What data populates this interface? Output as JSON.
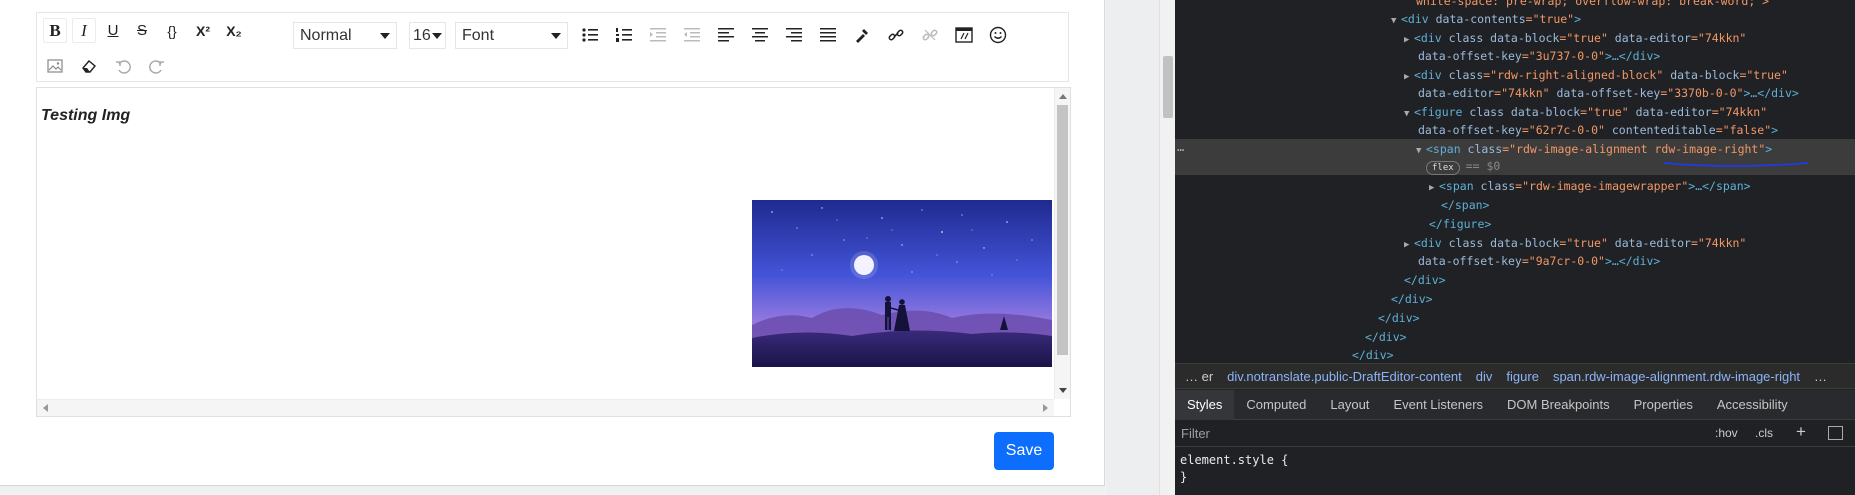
{
  "toolbar": {
    "buttons_row1": [
      {
        "name": "bold",
        "glyph": "B"
      },
      {
        "name": "italic",
        "glyph": "I"
      },
      {
        "name": "underline",
        "glyph": "U"
      },
      {
        "name": "strikethrough",
        "glyph": "S"
      },
      {
        "name": "code",
        "glyph": "{}"
      },
      {
        "name": "superscript",
        "glyph": "X²"
      },
      {
        "name": "subscript",
        "glyph": "X₂"
      }
    ],
    "block_type": "Normal",
    "font_size": "16",
    "font_family": "Font",
    "icons": [
      "unordered-list-icon",
      "ordered-list-icon",
      "indent-icon",
      "outdent-icon",
      "align-left-icon",
      "align-center-icon",
      "align-right-icon",
      "align-justify-icon",
      "color-picker-icon",
      "link-icon",
      "unlink-icon",
      "embed-icon",
      "emoji-icon",
      "image-icon",
      "eraser-icon",
      "undo-icon",
      "redo-icon"
    ]
  },
  "editor": {
    "text": "Testing Img",
    "image_icon": "night-sky-couple-image"
  },
  "save_label": "Save",
  "devtools": {
    "lines": {
      "l0": "white-space: pre-wrap; overflow-wrap: break-word;\">",
      "l1a": "<div ",
      "l1b": "data-contents",
      "l1c": "=\"true\"",
      "l1d": ">",
      "l2a": "<div ",
      "l2b": "class data-block",
      "l2c": "=\"true\"",
      "l2d": " data-editor",
      "l2e": "=\"74kkn\"",
      "l3a": "data-offset-key",
      "l3b": "=\"3u737-0-0\"",
      "l3c": ">…</div>",
      "l4a": "<div ",
      "l4b": "class",
      "l4c": "=\"rdw-right-aligned-block\"",
      "l4d": " data-block",
      "l4e": "=\"true\"",
      "l5a": "data-editor",
      "l5b": "=\"74kkn\"",
      "l5c": " data-offset-key",
      "l5d": "=\"3370b-0-0\"",
      "l5e": ">…</div>",
      "l6a": "<figure ",
      "l6b": "class data-block",
      "l6c": "=\"true\"",
      "l6d": " data-editor",
      "l6e": "=\"74kkn\"",
      "l7a": "data-offset-key",
      "l7b": "=\"62r7c-0-0\"",
      "l7c": " contenteditable",
      "l7d": "=\"false\"",
      "l7e": ">",
      "l8a": "<span ",
      "l8b": "class",
      "l8c": "=\"rdw-image-alignment rdw-image-right\"",
      "l8d": ">",
      "l9a": "flex",
      "l9b": "== $0",
      "l10a": "<span ",
      "l10b": "class",
      "l10c": "=\"rdw-image-imagewrapper\"",
      "l10d": ">…</span>",
      "l11": "</span>",
      "l12": "</figure>",
      "l13a": "<div ",
      "l13b": "class data-block",
      "l13c": "=\"true\"",
      "l13d": " data-editor",
      "l13e": "=\"74kkn\"",
      "l14a": "data-offset-key",
      "l14b": "=\"9a7cr-0-0\"",
      "l14c": ">…</div>",
      "l15": "</div>",
      "l16": "</div>",
      "l17": "</div>",
      "l18": "</div>",
      "l19": "</div>"
    },
    "dots": "…",
    "breadcrumb": [
      "… er",
      "div.notranslate.public-DraftEditor-content",
      "div",
      "figure",
      "span.rdw-image-alignment.rdw-image-right",
      "…"
    ],
    "tabs": [
      "Styles",
      "Computed",
      "Layout",
      "Event Listeners",
      "DOM Breakpoints",
      "Properties",
      "Accessibility"
    ],
    "filter_placeholder": "Filter",
    "hov": ":hov",
    "cls": ".cls",
    "plus": "+",
    "styles": {
      "selector": "element.style",
      "open": " {",
      "close": "}"
    },
    "colors": {
      "tag": "#5db0d7",
      "attr": "#9bbbdc",
      "value": "#f29766",
      "bg": "#202124",
      "selected_bg": "#3c3c3c"
    }
  },
  "colors": {
    "save_button": "#0d6efd"
  }
}
